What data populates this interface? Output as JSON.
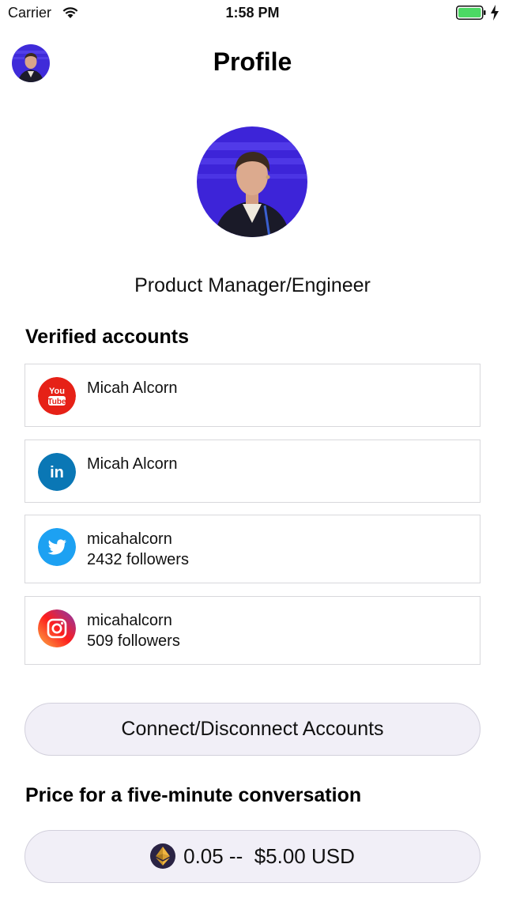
{
  "status_bar": {
    "carrier": "Carrier",
    "time": "1:58 PM",
    "battery_color": "#4cd964"
  },
  "header": {
    "title": "Profile",
    "avatar_icon": "user-avatar"
  },
  "profile": {
    "photo_icon": "profile-photo",
    "role": "Product Manager/Engineer"
  },
  "verified": {
    "title": "Verified accounts",
    "accounts": [
      {
        "service": "YouTube",
        "icon": "youtube-icon",
        "icon_text_top": "You",
        "icon_text_bottom": "Tube",
        "name": "Micah Alcorn",
        "followers": ""
      },
      {
        "service": "LinkedIn",
        "icon": "linkedin-icon",
        "icon_text": "in",
        "name": "Micah Alcorn",
        "followers": ""
      },
      {
        "service": "Twitter",
        "icon": "twitter-icon",
        "name": "micahalcorn",
        "followers": "2432 followers"
      },
      {
        "service": "Instagram",
        "icon": "instagram-icon",
        "name": "micahalcorn",
        "followers": "509 followers"
      }
    ]
  },
  "connect": {
    "label": "Connect/Disconnect Accounts"
  },
  "price": {
    "title": "Price for a five-minute conversation",
    "amount": "0.05 --  $5.00 USD",
    "currency_icon": "ethereum-icon"
  },
  "colors": {
    "youtube": "#e62117",
    "linkedin": "#0a77b5",
    "twitter": "#1da1f2",
    "pill_bg": "#f1eff7"
  }
}
